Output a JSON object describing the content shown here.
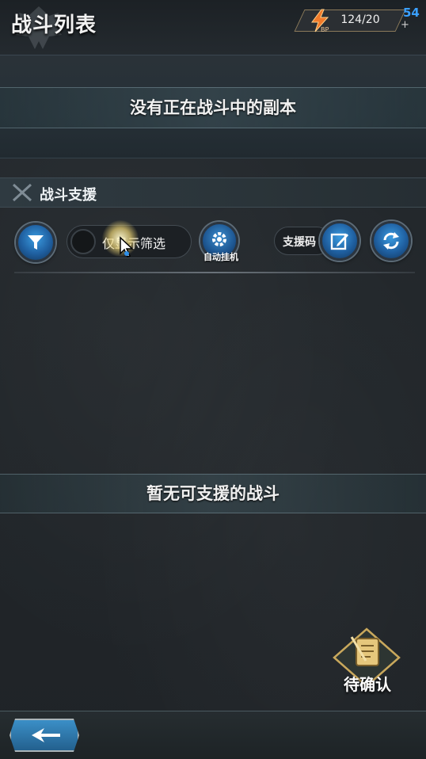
{
  "header": {
    "title": "战斗列表",
    "bp_value": "124/20",
    "bp_icon_label": "BP",
    "bp_plus": "+",
    "counter": "54"
  },
  "battle_list": {
    "empty_message": "没有正在战斗中的副本"
  },
  "support": {
    "title": "战斗支援",
    "filter_toggle_label": "仅显示筛选",
    "auto_hangup_label": "自动挂机",
    "support_code_label": "支援码",
    "empty_message": "暂无可支援的战斗"
  },
  "pending": {
    "label": "待确认"
  },
  "icons": {
    "filter": "funnel-icon",
    "settings": "gear-icon",
    "edit": "edit-icon",
    "refresh": "refresh-icon",
    "bp": "lightning-icon",
    "back": "back-arrow-icon",
    "pending": "scroll-sword-icon"
  },
  "colors": {
    "accent_blue": "#2f7fc4",
    "counter_blue": "#3aa0ff",
    "gold": "#c9a85c"
  }
}
